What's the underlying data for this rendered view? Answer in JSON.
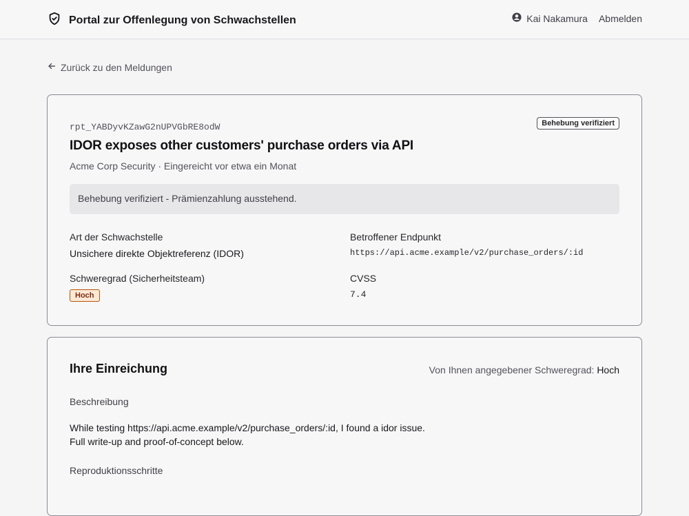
{
  "header": {
    "title": "Portal zur Offenlegung von Schwachstellen",
    "user_name": "Kai Nakamura",
    "logout_label": "Abmelden"
  },
  "nav": {
    "back_label": "Zurück zu den Meldungen"
  },
  "report": {
    "id": "rpt_YABDyvKZawG2nUPVGbRE8odW",
    "status_badge": "Behebung verifiziert",
    "title": "IDOR exposes other customers' purchase orders via API",
    "meta": "Acme Corp Security · Eingereicht vor etwa ein Monat",
    "notice": "Behebung verifiziert - Prämienzahlung ausstehend.",
    "fields": {
      "vuln_type_label": "Art der Schwachstelle",
      "vuln_type_value": "Unsichere direkte Objektreferenz (IDOR)",
      "endpoint_label": "Betroffener Endpunkt",
      "endpoint_value": "https://api.acme.example/v2/purchase_orders/:id",
      "severity_label": "Schweregrad (Sicherheitsteam)",
      "severity_value": "Hoch",
      "cvss_label": "CVSS",
      "cvss_value": "7.4"
    }
  },
  "submission": {
    "title": "Ihre Einreichung",
    "given_severity_label": "Von Ihnen angegebener Schweregrad:",
    "given_severity_value": "Hoch",
    "description_label": "Beschreibung",
    "description_line1": "While testing https://api.acme.example/v2/purchase_orders/:id, I found a idor issue.",
    "description_line2": "Full write-up and proof-of-concept below.",
    "repro_label": "Reproduktionsschritte"
  },
  "colors": {
    "severity_badge_bg": "#fde9d6",
    "severity_badge_border": "#b45309",
    "notice_bg": "#e7e7ea"
  }
}
